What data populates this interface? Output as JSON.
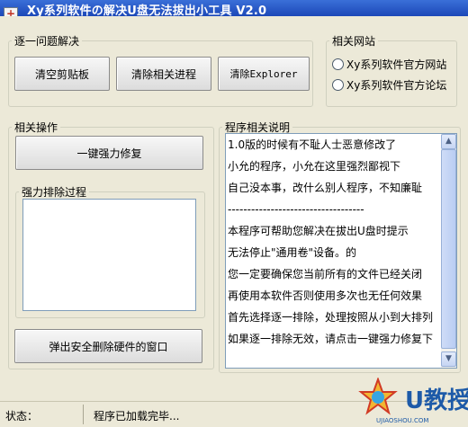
{
  "window": {
    "title": "Xy系列软件の解决U盘无法拔出小工具 V2.0"
  },
  "group_one_by_one": {
    "legend": "逐一问题解决",
    "buttons": [
      "清空剪贴板",
      "清除相关进程",
      "清除Explorer"
    ]
  },
  "group_sites": {
    "legend": "相关网站",
    "options": [
      "Xy系列软件官方网站",
      "Xy系列软件官方论坛"
    ]
  },
  "group_ops": {
    "legend": "相关操作",
    "force_repair_button": "一键强力修复",
    "process_legend": "强力排除过程",
    "eject_button": "弹出安全删除硬件的窗口"
  },
  "group_desc": {
    "legend": "程序相关说明",
    "lines": [
      "1.0版的时候有不耻人士恶意修改了",
      "小允的程序，小允在这里强烈鄙视下",
      "自己没本事，改什么别人程序，不知廉耻",
      "-----------------------------------",
      "本程序可帮助您解决在拔出U盘时提示",
      "无法停止\"通用卷\"设备。的",
      "您一定要确保您当前所有的文件已经关闭",
      "再使用本软件否则使用多次也无任何效果",
      "首先选择逐一排除，处理按照从小到大排列",
      "如果逐一排除无效，请点击一键强力修复下"
    ]
  },
  "status": {
    "label": "状态：",
    "message": "程序已加载完毕..."
  },
  "watermark": {
    "brand": "U教授",
    "url": "UJIAOSHOU.COM"
  },
  "icons": {
    "app": "app-icon",
    "scroll_up": "scroll-up-icon",
    "scroll_down": "scroll-down-icon"
  },
  "colors": {
    "titlebar": "#2a5bd0",
    "window_bg": "#ece9d8",
    "field_border": "#7f9db9"
  }
}
